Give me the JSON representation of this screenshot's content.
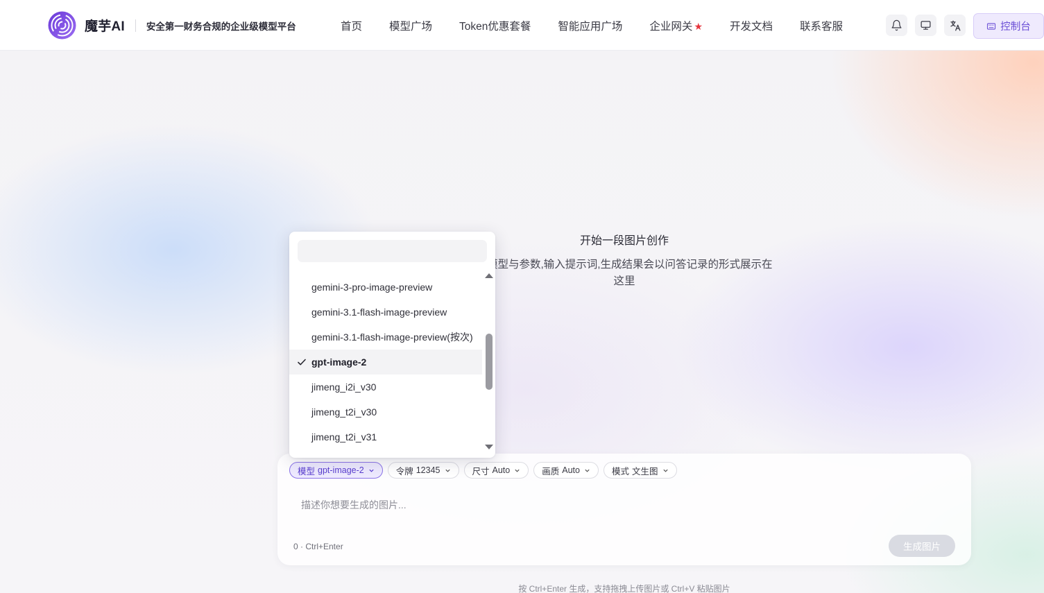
{
  "header": {
    "brand": "魔芋AI",
    "slogan": "安全第一财务合规的企业级模型平台",
    "nav": [
      {
        "label": "首页"
      },
      {
        "label": "模型广场"
      },
      {
        "label": "Token优惠套餐"
      },
      {
        "label": "智能应用广场"
      },
      {
        "label": "企业网关",
        "badge": "★"
      },
      {
        "label": "开发文档"
      },
      {
        "label": "联系客服"
      }
    ],
    "icons": [
      "bell-icon",
      "monitor-icon",
      "translate-icon"
    ],
    "console_label": "控制台"
  },
  "empty_state": {
    "title": "开始一段图片创作",
    "description": "择模型与参数,输入提示词,生成结果会以问答记录的形式展示在这里"
  },
  "model_dropdown": {
    "search_placeholder": "",
    "items": [
      {
        "label": "gemini-3-pro-image-preview",
        "selected": false
      },
      {
        "label": "gemini-3.1-flash-image-preview",
        "selected": false
      },
      {
        "label": "gemini-3.1-flash-image-preview(按次)",
        "selected": false
      },
      {
        "label": "gpt-image-2",
        "selected": true
      },
      {
        "label": "jimeng_i2i_v30",
        "selected": false
      },
      {
        "label": "jimeng_t2i_v30",
        "selected": false
      },
      {
        "label": "jimeng_t2i_v31",
        "selected": false
      }
    ]
  },
  "composer": {
    "chips": [
      {
        "label": "模型",
        "value": "gpt-image-2",
        "active": true
      },
      {
        "label": "令牌",
        "value": "12345",
        "active": false
      },
      {
        "label": "尺寸",
        "value": "Auto",
        "active": false
      },
      {
        "label": "画质",
        "value": "Auto",
        "active": false
      },
      {
        "label": "模式",
        "value": "文生图",
        "active": false
      }
    ],
    "prompt_placeholder": "描述你想要生成的图片...",
    "counter": "0 · Ctrl+Enter",
    "generate_label": "生成图片"
  },
  "footnote": "按 Ctrl+Enter 生成，支持拖拽上传图片或 Ctrl+V 粘贴图片",
  "colors": {
    "accent": "#6b4fd6",
    "star": "#e5343d",
    "generate_disabled": "#d9dbe2"
  }
}
